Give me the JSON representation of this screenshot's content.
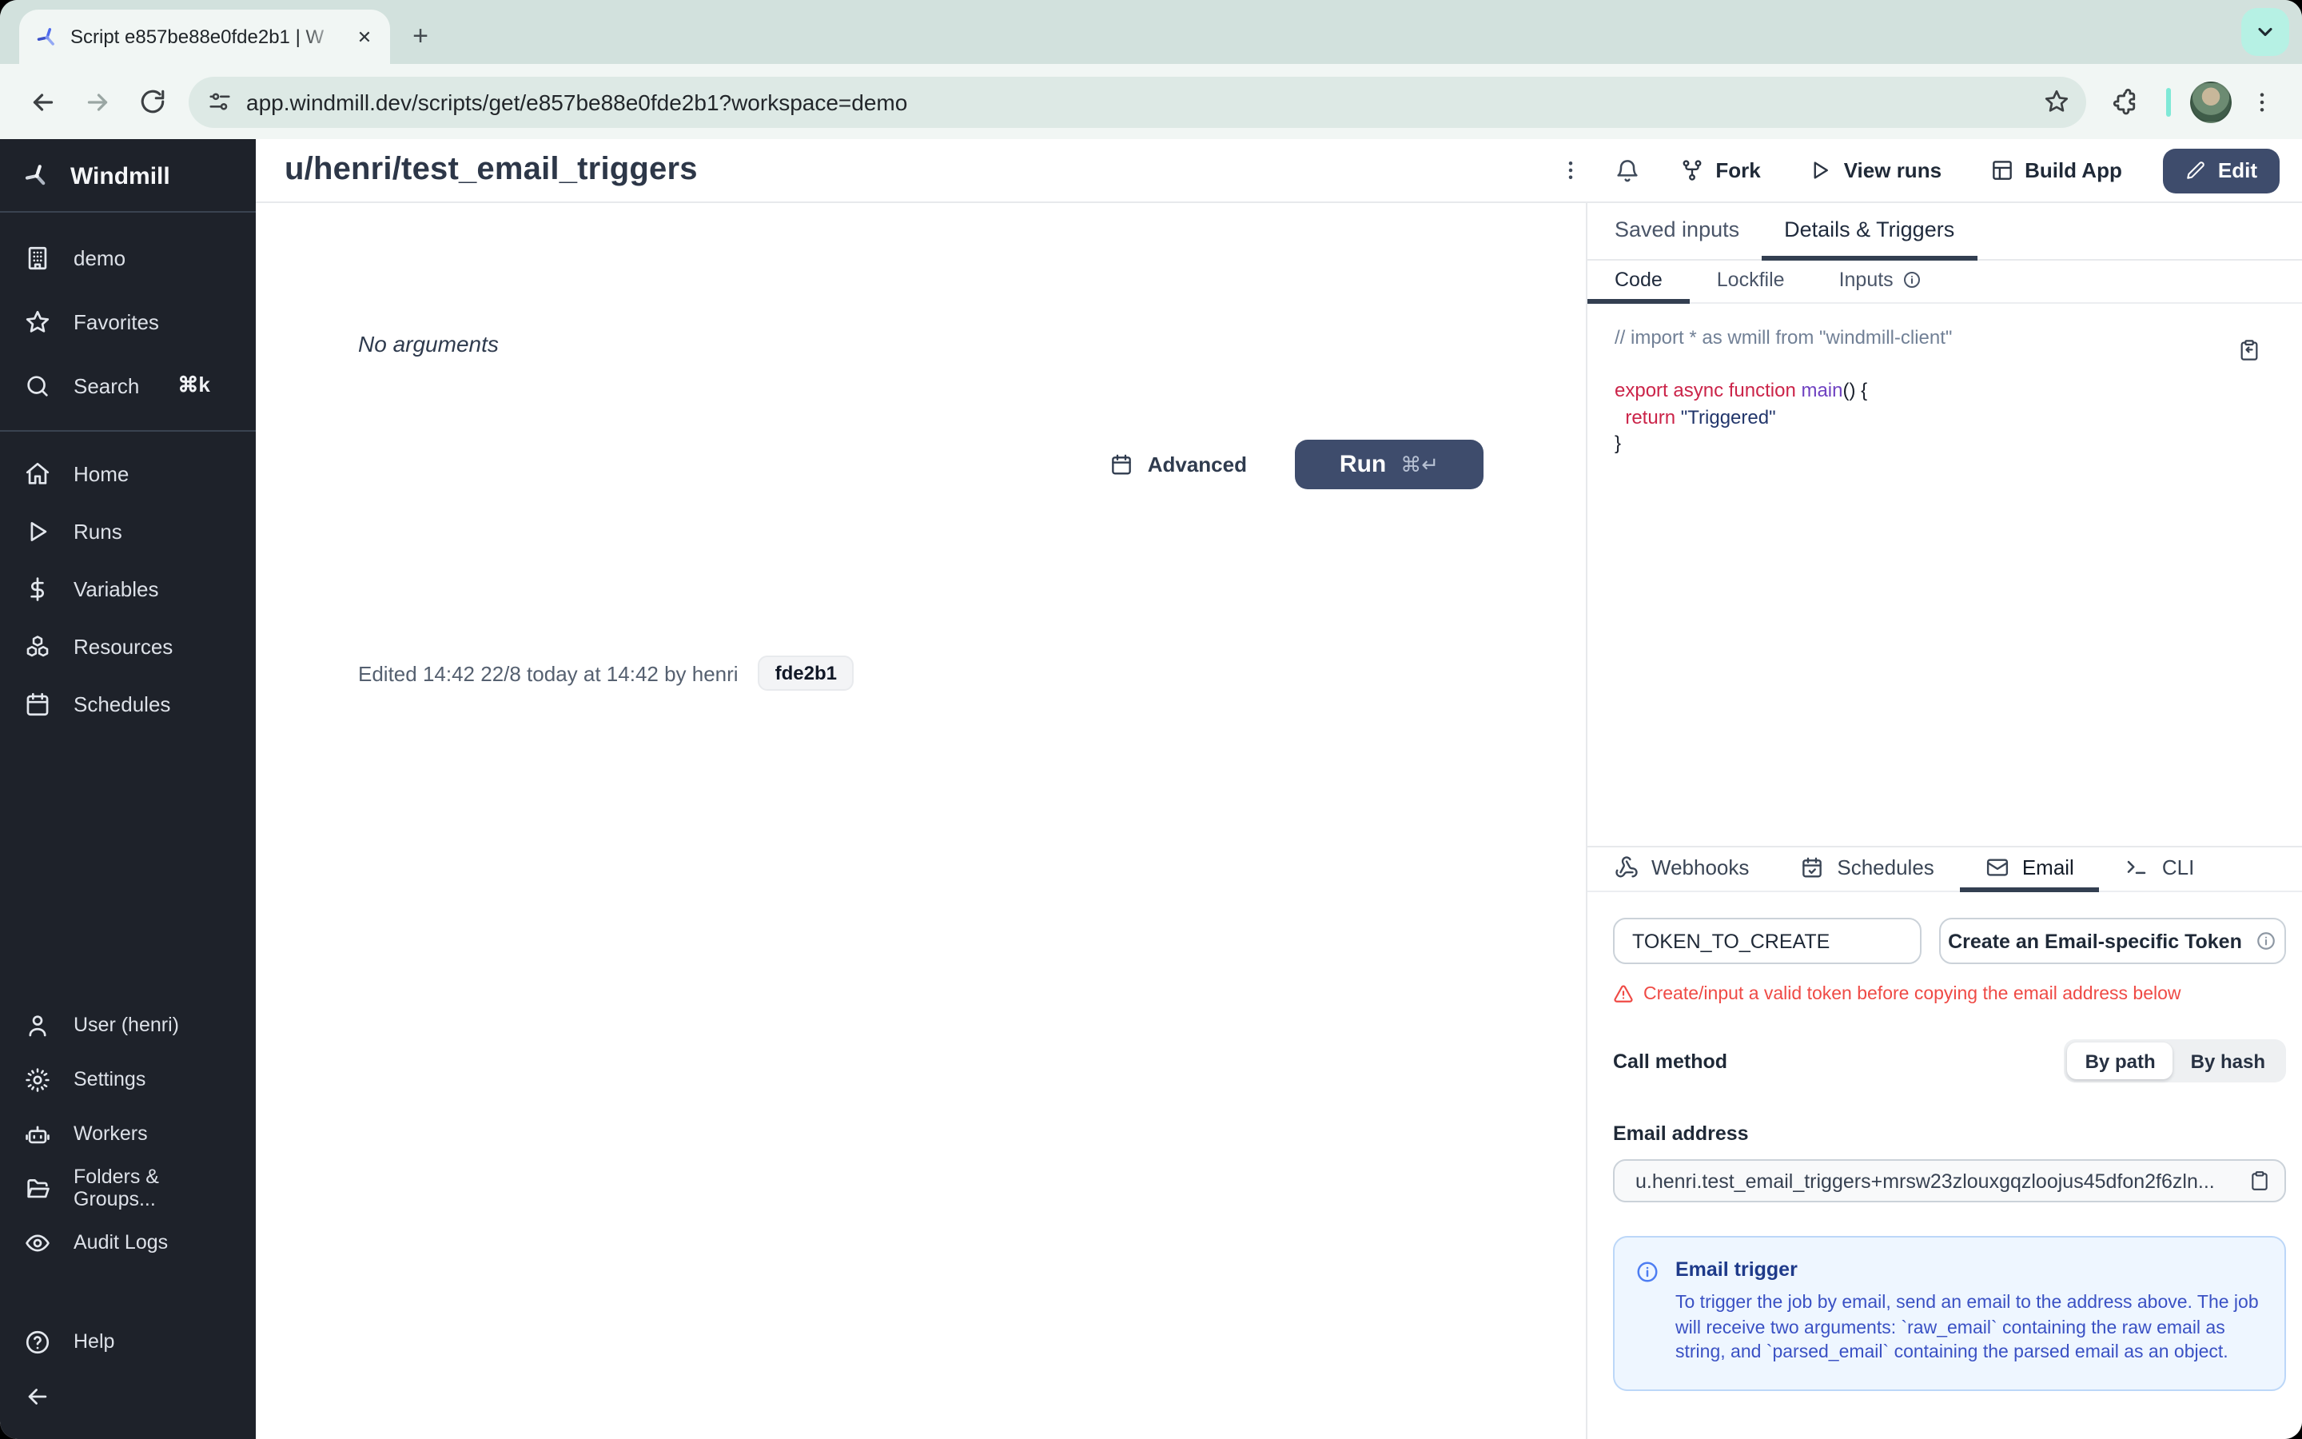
{
  "browser": {
    "tab_title": "Script e857be88e0fde2b1 | W",
    "url": "app.windmill.dev/scripts/get/e857be88e0fde2b1?workspace=demo"
  },
  "sidebar": {
    "brand": "Windmill",
    "workspace": "demo",
    "favorites": "Favorites",
    "search": "Search",
    "search_kbd": "⌘k",
    "home": "Home",
    "runs": "Runs",
    "variables": "Variables",
    "resources": "Resources",
    "schedules": "Schedules",
    "user": "User (henri)",
    "settings": "Settings",
    "workers": "Workers",
    "folders": "Folders & Groups...",
    "audit": "Audit Logs",
    "help": "Help"
  },
  "header": {
    "title": "u/henri/test_email_triggers",
    "fork": "Fork",
    "view_runs": "View runs",
    "build_app": "Build App",
    "edit": "Edit"
  },
  "main": {
    "no_arguments": "No arguments",
    "advanced": "Advanced",
    "run": "Run",
    "run_kbd": "⌘↵",
    "edited": "Edited 14:42 22/8 today at 14:42 by henri",
    "hash": "fde2b1"
  },
  "panel": {
    "tab_saved": "Saved inputs",
    "tab_details": "Details & Triggers",
    "sub_code": "Code",
    "sub_lockfile": "Lockfile",
    "sub_inputs": "Inputs"
  },
  "code": {
    "line1": "// import * as wmill from \"windmill-client\"",
    "line3_kw": "export async function ",
    "line3_fn": "main",
    "line3_punct": "() {",
    "line4_indent": "  ",
    "line4_kw": "return",
    "line4_sp": " ",
    "line4_str": "\"Triggered\"",
    "line5": "}"
  },
  "triggers": {
    "webhooks": "Webhooks",
    "schedules": "Schedules",
    "email": "Email",
    "cli": "CLI"
  },
  "email": {
    "token_value": "TOKEN_TO_CREATE",
    "create_button": "Create an Email-specific Token",
    "warning": "Create/input a valid token before copying the email address below",
    "call_method": "Call method",
    "by_path": "By path",
    "by_hash": "By hash",
    "address_label": "Email address",
    "address_value": "u.henri.test_email_triggers+mrsw23zlouxgqzloojus45dfon2f6zln...",
    "info_title": "Email trigger",
    "info_body": "To trigger the job by email, send an email to the address above. The job will receive two arguments: `raw_email` containing the raw email as string, and `parsed_email` containing the parsed email as an object."
  },
  "colors": {
    "accent_button": "#3e4c6c",
    "danger": "#ef4a45",
    "info_bg": "#eef6ff",
    "info_text": "#3a51c4",
    "sidebar_bg": "#1e222a",
    "chrome_bg": "#d2e1dd"
  }
}
